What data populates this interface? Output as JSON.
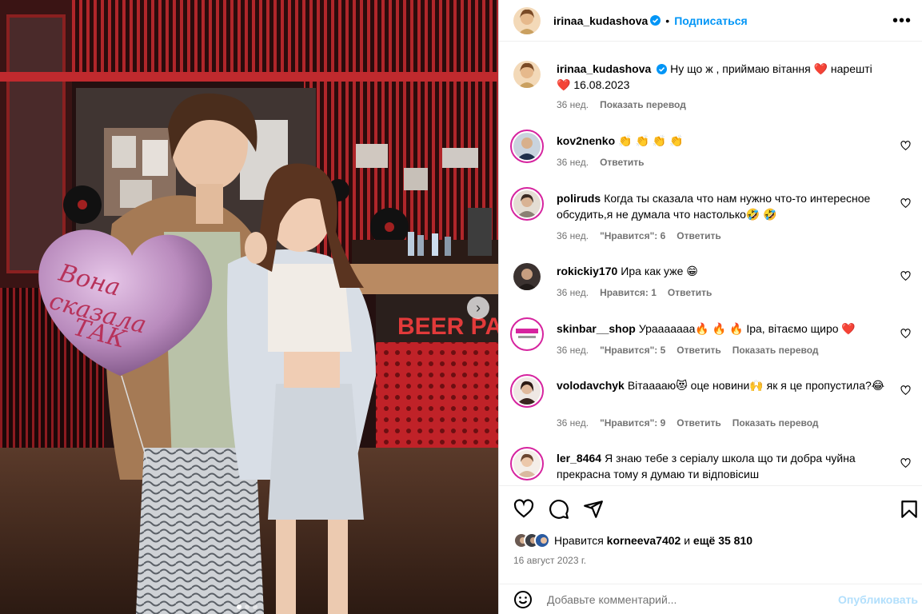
{
  "photo": {
    "balloon_text": [
      "Вона",
      "сказала",
      "ТАК"
    ],
    "sign_text": "BEER PA",
    "dots": 3,
    "active_dot": 0
  },
  "header": {
    "username": "irinaa_kudashova",
    "separator": "•",
    "follow_label": "Подписаться",
    "more_icon": "more-horizontal-icon"
  },
  "caption": {
    "username": "irinaa_kudashova",
    "text_line1": "Ну що ж , приймаю вітання",
    "heart1": "❤️",
    "word_finally": "нарешті",
    "heart2": "❤️",
    "date_text": "16.08.2023",
    "age": "36 нед.",
    "translate": "Показать перевод"
  },
  "comments": [
    {
      "username": "kov2nenko",
      "text": "👏 👏 👏 👏",
      "age": "36 нед.",
      "likes": "",
      "reply": "Ответить",
      "translate": ""
    },
    {
      "username": "poliruds",
      "text": "Когда ты сказала что нам нужно что-то интересное обсудить,я не думала что настолько🤣 🤣",
      "age": "36 нед.",
      "likes": "\"Нравится\": 6",
      "reply": "Ответить",
      "translate": ""
    },
    {
      "username": "rokickiy170",
      "text": "Ира как уже 😁",
      "age": "36 нед.",
      "likes": "Нравится: 1",
      "reply": "Ответить",
      "translate": ""
    },
    {
      "username": "skinbar__shop",
      "text": "Урааааааа🔥 🔥 🔥 Іра, вітаємо щиро ❤️",
      "age": "36 нед.",
      "likes": "\"Нравится\": 5",
      "reply": "Ответить",
      "translate": "Показать перевод"
    },
    {
      "username": "volodavchyk",
      "text": "Вітааааю😻 оце новини🙌 як я це пропустила?😂",
      "age": "36 нед.",
      "likes": "\"Нравится\": 9",
      "reply": "Ответить",
      "translate": "Показать перевод"
    },
    {
      "username": "ler_8464",
      "text": "Я знаю тебе з серіалу школа що ти добра чуйна прекрасна тому я думаю ти відповісиш",
      "age": "",
      "likes": "",
      "reply": "",
      "translate": ""
    }
  ],
  "actions": {
    "like_icon": "heart-icon",
    "comment_icon": "comment-icon",
    "share_icon": "send-icon",
    "save_icon": "bookmark-icon"
  },
  "likes": {
    "prefix": "Нравится",
    "user": "korneeva7402",
    "suffix_and": "и",
    "others": "ещё 35 810"
  },
  "post_date": "16 август 2023 г.",
  "add_comment": {
    "placeholder": "Добавьте комментарий...",
    "publish": "Опубликовать",
    "emoji_icon": "smile-icon"
  },
  "colors": {
    "accent": "#0095f6",
    "muted": "#737373",
    "publish_disabled": "#b2dffc",
    "story_ring": "#d6249f"
  }
}
